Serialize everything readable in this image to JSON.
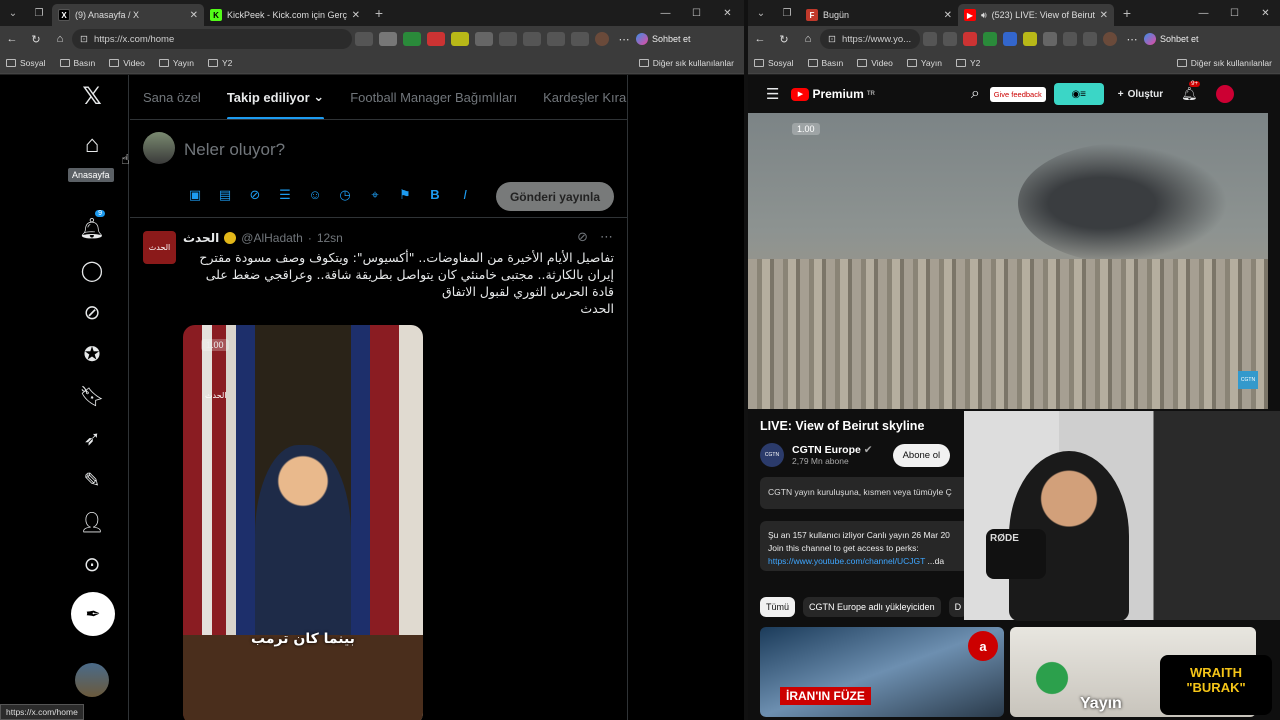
{
  "left_browser": {
    "tabs": [
      {
        "title": "(9) Anasayfa / X",
        "active": true,
        "favicon": "X"
      },
      {
        "title": "KickPeek - Kick.com için Gerçek Z",
        "active": false,
        "favicon": "K"
      }
    ],
    "url": "https://x.com/home",
    "copilot_label": "Sohbet et",
    "bookmarks": [
      "Sosyal",
      "Basın",
      "Video",
      "Yayın",
      "Y2"
    ],
    "bookmarks_other": "Diğer sık kullanılanlar",
    "status_url": "https://x.com/home"
  },
  "right_browser": {
    "tabs": [
      {
        "title": "Bugün",
        "active": false,
        "favicon": "F"
      },
      {
        "title": "(523) LIVE: View of Beirut skyli",
        "active": true,
        "favicon": "▶"
      }
    ],
    "url": "https://www.yo...",
    "copilot_label": "Sohbet et",
    "bookmarks": [
      "Sosyal",
      "Basın",
      "Video",
      "Yayın",
      "Y2"
    ],
    "bookmarks_other": "Diğer sık kullanılanlar"
  },
  "x": {
    "tooltip": "Anasayfa",
    "notif_badge": "9",
    "tabs": [
      "Sana özel",
      "Takip ediliyor",
      "Football Manager Bağımlıları",
      "Kardeşler Kıra"
    ],
    "active_tab": "Takip ediliyor",
    "compose_placeholder": "Neler oluyor?",
    "post_button": "Gönderi yayınla",
    "tweet": {
      "author": "الحدث",
      "handle": "@AlHadath",
      "time": "12sn",
      "avatar_text": "الحدث",
      "text": "تفاصيل الأيام الأخيرة من المفاوضات.. \"أكسيوس\": ويتكوف وصف مسودة مقترح إيران بالكارثة.. مجتبى خامنئي كان يتواصل بطريقة شاقة.. وعراقجي ضغط على قادة الحرس الثوري لقبول الاتفاق",
      "source": "الحدث",
      "media_rate": "1.00",
      "media_logo": "الحدث",
      "media_caption": "بينما كان ترمب"
    }
  },
  "yt": {
    "logo": "Premium",
    "logo_sup": "TR",
    "feedback_label": "Give feedback",
    "create_label": "Oluştur",
    "notif_badge": "9+",
    "video_rate": "1.00",
    "video_watermark": "CGTN",
    "title": "LIVE: View of Beirut skyline",
    "channel": "CGTN Europe",
    "subs": "2,79 Mn abone",
    "subscribe": "Abone ol",
    "notice": "CGTN yayın kuruluşuna, kısmen veya tümüyle Ç",
    "desc_line1": "Şu an 157 kullanıcı izliyor  Canlı yayın 26 Mar 20",
    "desc_line2": "Join this channel to get access to perks:",
    "desc_link": "https://www.youtube.com/channel/UCJGT",
    "desc_more": "...da",
    "chips": [
      "Tümü",
      "CGTN Europe adlı yükleyiciden",
      "D"
    ],
    "thumb1_text": "İRAN'IN FÜZE",
    "thumb1_badge": "a",
    "thumb2_text": "Yayın",
    "overlay_mic": "RØDE",
    "overlay_brand": "WRAITH\n\"BURAK\""
  }
}
